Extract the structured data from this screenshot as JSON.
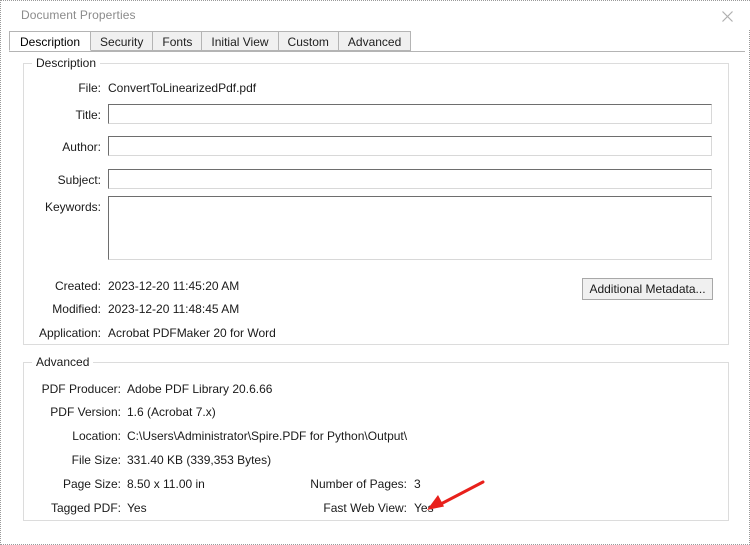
{
  "window": {
    "title": "Document Properties",
    "close_icon": "close-icon"
  },
  "tabs": [
    {
      "label": "Description",
      "active": true
    },
    {
      "label": "Security",
      "active": false
    },
    {
      "label": "Fonts",
      "active": false
    },
    {
      "label": "Initial View",
      "active": false
    },
    {
      "label": "Custom",
      "active": false
    },
    {
      "label": "Advanced",
      "active": false
    }
  ],
  "description": {
    "legend": "Description",
    "file_label": "File:",
    "file_value": "ConvertToLinearizedPdf.pdf",
    "title_label": "Title:",
    "title_value": "",
    "title_placeholder": "",
    "author_label": "Author:",
    "author_value": "",
    "author_placeholder": "",
    "subject_label": "Subject:",
    "subject_value": "",
    "subject_placeholder": "",
    "keywords_label": "Keywords:",
    "keywords_value": "",
    "keywords_placeholder": "",
    "created_label": "Created:",
    "created_value": "2023-12-20 11:45:20 AM",
    "modified_label": "Modified:",
    "modified_value": "2023-12-20 11:48:45 AM",
    "application_label": "Application:",
    "application_value": "Acrobat PDFMaker 20 for Word",
    "additional_metadata_button": "Additional Metadata..."
  },
  "advanced": {
    "legend": "Advanced",
    "producer_label": "PDF Producer:",
    "producer_value": "Adobe PDF Library 20.6.66",
    "version_label": "PDF Version:",
    "version_value": "1.6 (Acrobat 7.x)",
    "location_label": "Location:",
    "location_value": "C:\\Users\\Administrator\\Spire.PDF for Python\\Output\\",
    "filesize_label": "File Size:",
    "filesize_value": "331.40 KB (339,353 Bytes)",
    "pagesize_label": "Page Size:",
    "pagesize_value": "8.50 x 11.00 in",
    "numpages_label": "Number of Pages:",
    "numpages_value": "3",
    "tagged_label": "Tagged PDF:",
    "tagged_value": "Yes",
    "fastweb_label": "Fast Web View:",
    "fastweb_value": "Yes"
  },
  "annotation": {
    "name": "red-arrow-annotation",
    "color": "#e8201b",
    "points_at": "Fast Web View: Yes"
  }
}
